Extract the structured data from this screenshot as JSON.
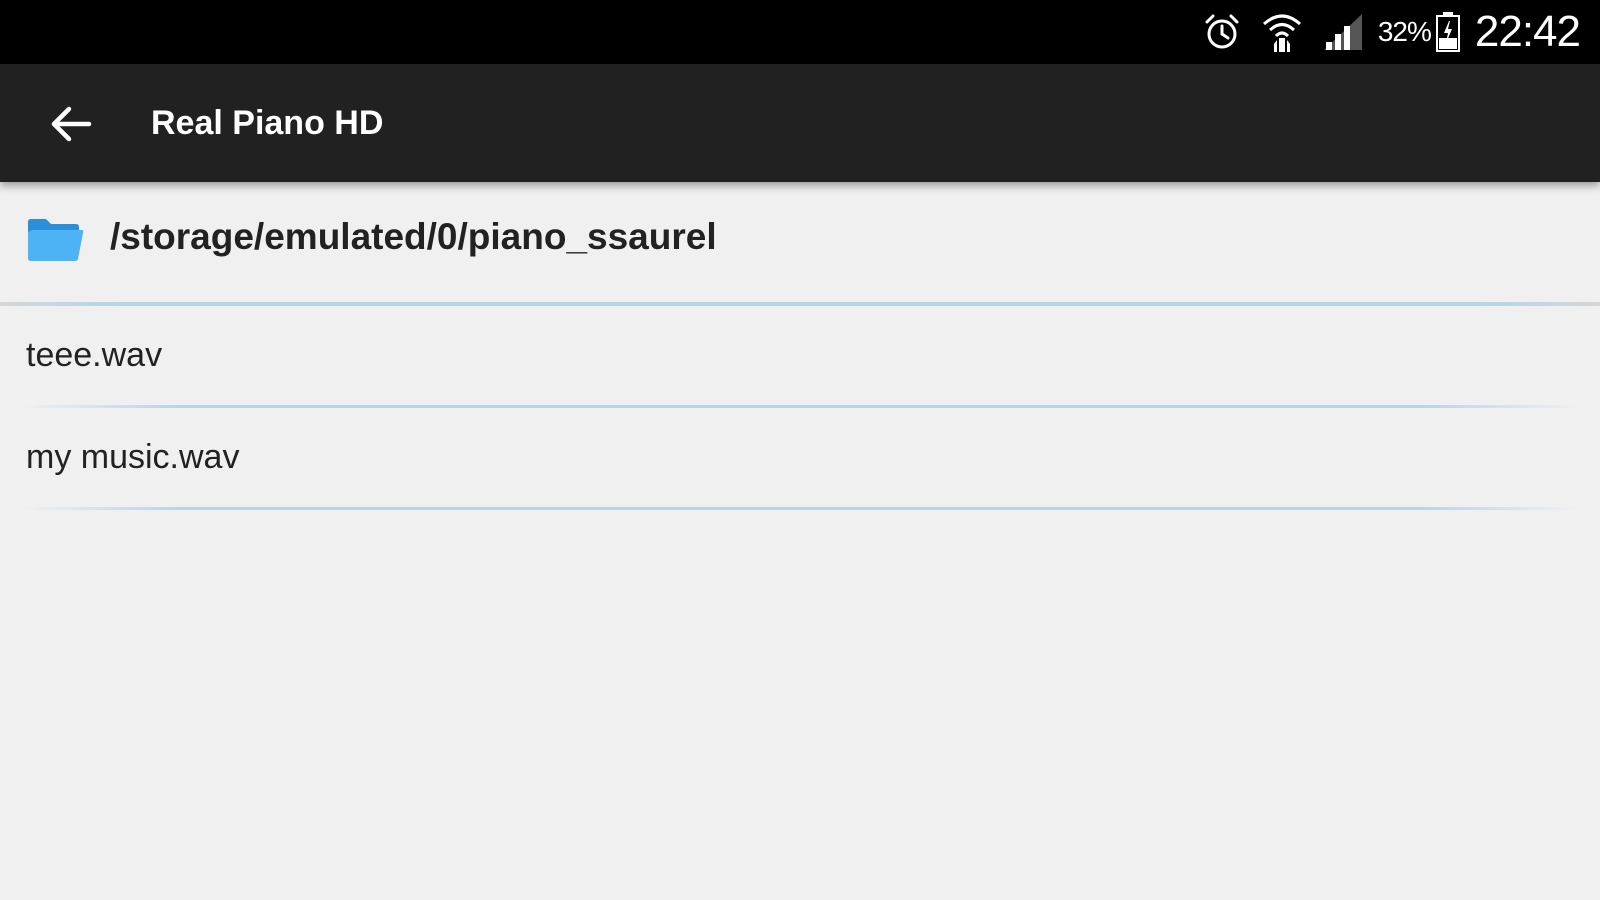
{
  "status_bar": {
    "icons": [
      "alarm-icon",
      "wifi-icon",
      "signal-icon",
      "battery-icon"
    ],
    "battery_percent": "32%",
    "time": "22:42"
  },
  "app_bar": {
    "back_icon": "arrow-left-icon",
    "title": "Real Piano HD"
  },
  "directory": {
    "icon": "folder-icon",
    "path": "/storage/emulated/0/piano_ssaurel"
  },
  "files": [
    {
      "name": "teee.wav"
    },
    {
      "name": "my music.wav"
    }
  ],
  "colors": {
    "status_bar_bg": "#000000",
    "app_bar_bg": "#212121",
    "background": "#f0f0f0",
    "folder_blue": "#42a5f5",
    "divider_blue": "#b8d5e6"
  }
}
